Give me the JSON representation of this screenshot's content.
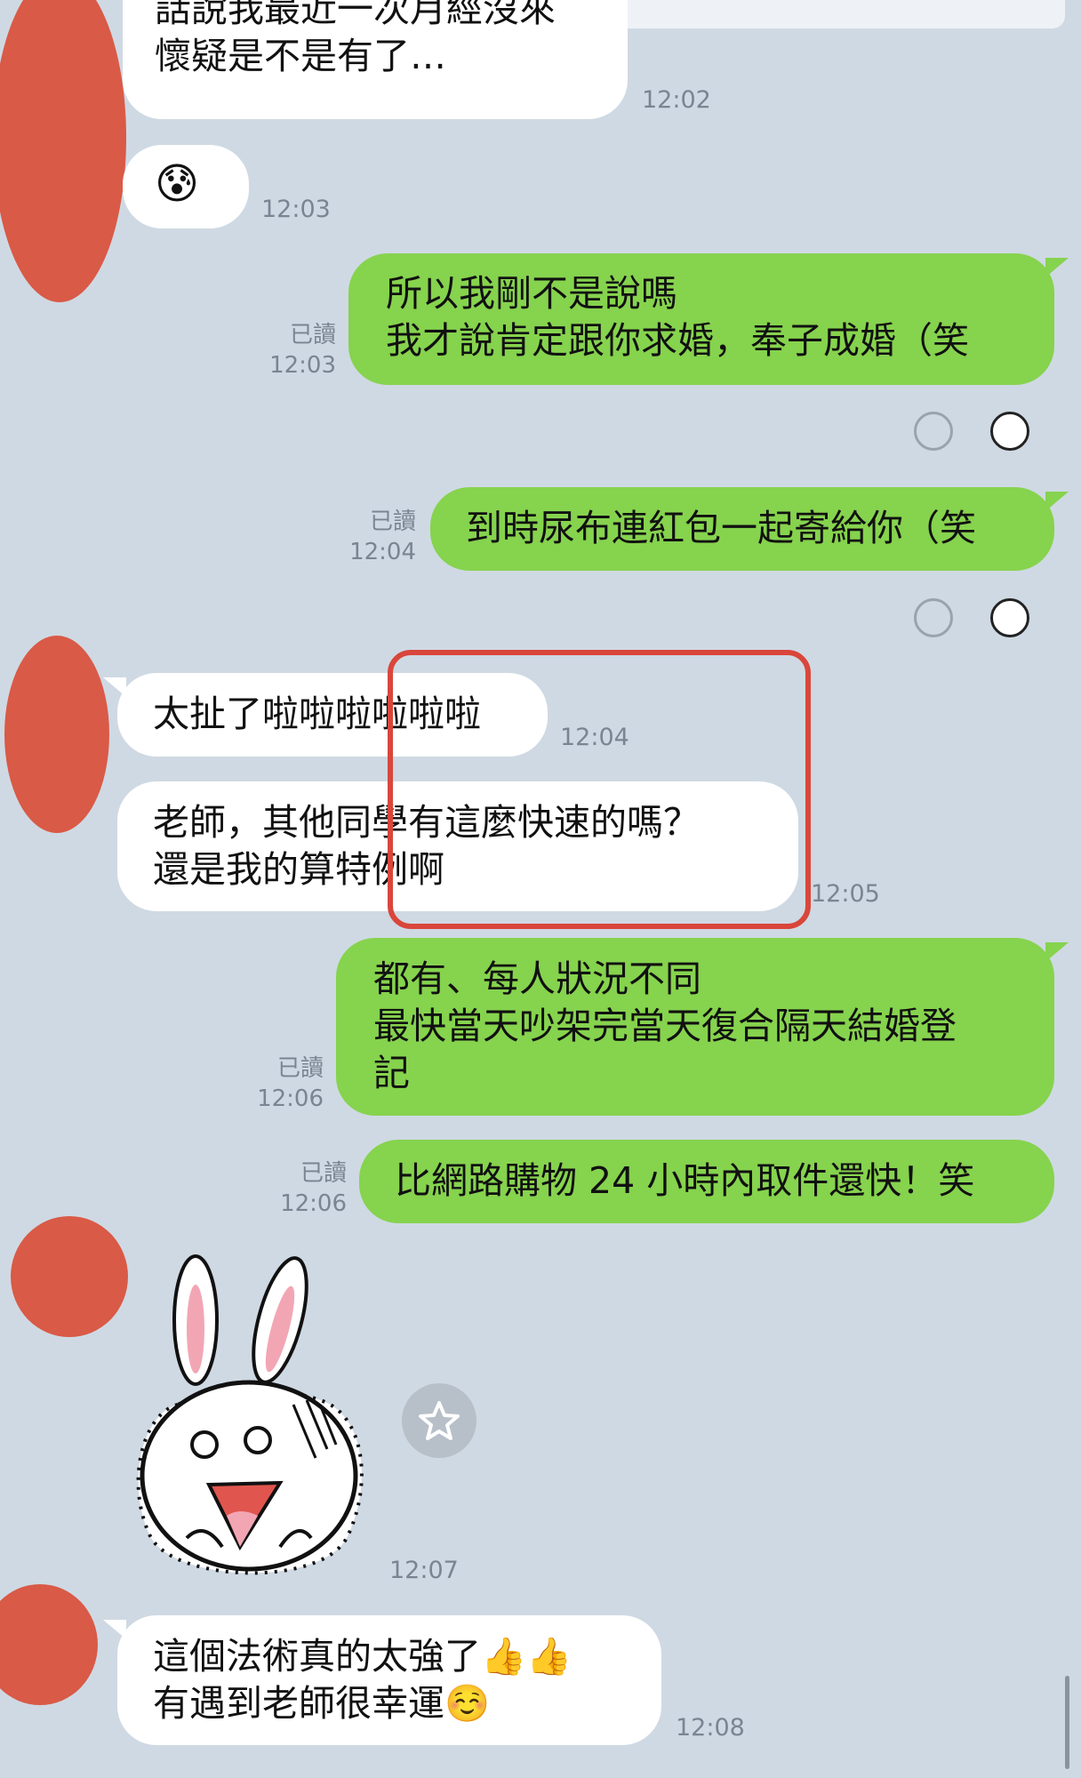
{
  "messages": {
    "m1": {
      "lines": [
        "話說我最近一次月經沒來",
        "懷疑是不是有了…"
      ],
      "time": "12:02"
    },
    "m2": {
      "emoji": "😰",
      "time": "12:03"
    },
    "m3": {
      "lines": [
        "所以我剛不是說嗎",
        "我才說肯定跟你求婚，奉子成婚（笑"
      ],
      "read": "已讀",
      "time": "12:03"
    },
    "m4": {
      "lines": [
        "到時尿布連紅包一起寄給你（笑"
      ],
      "read": "已讀",
      "time": "12:04"
    },
    "m5": {
      "lines": [
        "太扯了啦啦啦啦啦啦"
      ],
      "time": "12:04"
    },
    "m6": {
      "lines": [
        "老師，其他同學有這麼快速的嗎？",
        "還是我的算特例啊"
      ],
      "time": "12:05"
    },
    "m7": {
      "lines": [
        "都有、每人狀況不同",
        "最快當天吵架完當天復合隔天結婚登",
        "記"
      ],
      "read": "已讀",
      "time": "12:06"
    },
    "m8": {
      "lines": [
        "比網路購物 24 小時內取件還快！笑"
      ],
      "read": "已讀",
      "time": "12:06"
    },
    "m9": {
      "sticker": "shocked-bunny-sticker",
      "time": "12:07"
    },
    "m10": {
      "lines": [
        "這個法術真的太強了👍👍",
        "有遇到老師很幸運☺️"
      ],
      "time": "12:08"
    }
  },
  "reactions": {
    "r1": {
      "left": "smile-icon",
      "right": "surprised-face-icon"
    },
    "r2": {
      "left": "smile-icon",
      "right": "laughing-face-icon"
    }
  },
  "colors": {
    "background": "#cfd9e3",
    "incoming_bubble": "#ffffff",
    "outgoing_bubble": "#86d34e",
    "avatar": "#d95a46",
    "highlight": "#d9463b"
  }
}
